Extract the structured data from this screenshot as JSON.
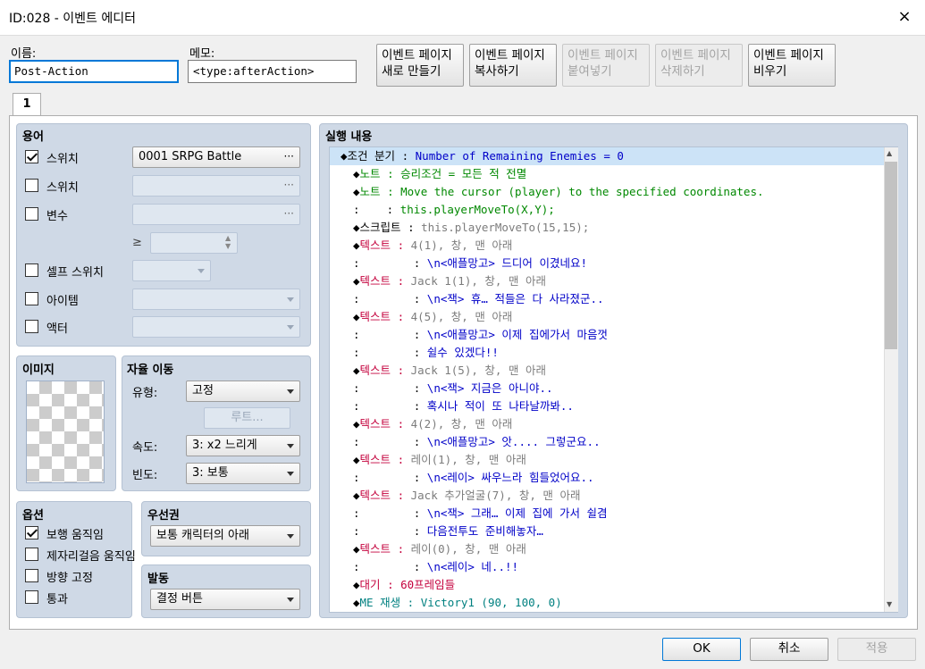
{
  "window": {
    "title": "ID:028 - 이벤트 에디터",
    "close_icon": "×"
  },
  "name": {
    "label": "이름:",
    "value": "Post-Action"
  },
  "memo": {
    "label": "메모:",
    "value": "<type:afterAction>"
  },
  "page_buttons": [
    {
      "line1": "이벤트 페이지",
      "line2": "새로 만들기",
      "enabled": true
    },
    {
      "line1": "이벤트 페이지",
      "line2": "복사하기",
      "enabled": true
    },
    {
      "line1": "이벤트 페이지",
      "line2": "붙여넣기",
      "enabled": false
    },
    {
      "line1": "이벤트 페이지",
      "line2": "삭제하기",
      "enabled": false
    },
    {
      "line1": "이벤트 페이지",
      "line2": "비우기",
      "enabled": true
    }
  ],
  "tab": {
    "label": "1"
  },
  "conditions": {
    "title": "용어",
    "switch1": {
      "label": "스위치",
      "checked": true,
      "value": "0001 SRPG Battle"
    },
    "switch2": {
      "label": "스위치",
      "checked": false
    },
    "variable": {
      "label": "변수",
      "checked": false,
      "ge": "≥"
    },
    "self_switch": {
      "label": "셀프 스위치",
      "checked": false
    },
    "item": {
      "label": "아이템",
      "checked": false
    },
    "actor": {
      "label": "액터",
      "checked": false
    },
    "dots": "···"
  },
  "image": {
    "title": "이미지"
  },
  "autonomous": {
    "title": "자율 이동",
    "type_label": "유형:",
    "type_value": "고정",
    "route_label": "루트...",
    "speed_label": "속도:",
    "speed_value": "3: x2 느리게",
    "freq_label": "빈도:",
    "freq_value": "3: 보통"
  },
  "options": {
    "title": "옵션",
    "items": [
      {
        "label": "보행 움직임",
        "checked": true
      },
      {
        "label": "제자리걸음 움직임",
        "checked": false
      },
      {
        "label": "방향 고정",
        "checked": false
      },
      {
        "label": "통과",
        "checked": false
      }
    ]
  },
  "priority": {
    "title": "우선권",
    "value": "보통 캐릭터의 아래"
  },
  "trigger": {
    "title": "발동",
    "value": "결정 버튼"
  },
  "contents": {
    "title": "실행 내용",
    "lines": [
      {
        "indent": 0,
        "prefix": "◆",
        "cmd": "조건 분기",
        "sep": " : ",
        "text": "Number of Remaining Enemies = 0",
        "cls": "c-blue",
        "cmdcls": "dia"
      },
      {
        "indent": 1,
        "prefix": "◆",
        "cmd": "노트",
        "sep": " : ",
        "text": "승리조건 = 모든 적 전멸",
        "cls": "c-green",
        "cmdcls": "c-green"
      },
      {
        "indent": 1,
        "prefix": "◆",
        "cmd": "노트",
        "sep": " : ",
        "text": "Move the cursor (player) to the specified coordinates.",
        "cls": "c-green",
        "cmdcls": "c-green"
      },
      {
        "indent": 1,
        "prefix": "",
        "cmd": ":",
        "sep": "    : ",
        "text": "this.playerMoveTo(X,Y);",
        "cls": "c-green",
        "cmdcls": "dia"
      },
      {
        "indent": 1,
        "prefix": "◆",
        "cmd": "스크립트",
        "sep": " : ",
        "text": "this.playerMoveTo(15,15);",
        "cls": "c-gray",
        "cmdcls": "dia"
      },
      {
        "indent": 1,
        "prefix": "◆",
        "cmd": "텍스트",
        "sep": " : ",
        "text": "4(1), 창, 맨 아래",
        "cls": "c-gray",
        "cmdcls": "c-red"
      },
      {
        "indent": 1,
        "prefix": "",
        "cmd": ":",
        "sep": "        : ",
        "text": "\\n<애플망고> 드디어 이겼네요!",
        "cls": "c-blue",
        "cmdcls": "dia"
      },
      {
        "indent": 1,
        "prefix": "◆",
        "cmd": "텍스트",
        "sep": " : ",
        "text": "Jack 1(1), 창, 맨 아래",
        "cls": "c-gray",
        "cmdcls": "c-red"
      },
      {
        "indent": 1,
        "prefix": "",
        "cmd": ":",
        "sep": "        : ",
        "text": "\\n<잭> 휴… 적들은 다 사라졌군..",
        "cls": "c-blue",
        "cmdcls": "dia"
      },
      {
        "indent": 1,
        "prefix": "◆",
        "cmd": "텍스트",
        "sep": " : ",
        "text": "4(5), 창, 맨 아래",
        "cls": "c-gray",
        "cmdcls": "c-red"
      },
      {
        "indent": 1,
        "prefix": "",
        "cmd": ":",
        "sep": "        : ",
        "text": "\\n<애플망고> 이제 집에가서 마음껏",
        "cls": "c-blue",
        "cmdcls": "dia"
      },
      {
        "indent": 1,
        "prefix": "",
        "cmd": ":",
        "sep": "        : ",
        "text": "쉴수 있겠다!!",
        "cls": "c-blue",
        "cmdcls": "dia"
      },
      {
        "indent": 1,
        "prefix": "◆",
        "cmd": "텍스트",
        "sep": " : ",
        "text": "Jack 1(5), 창, 맨 아래",
        "cls": "c-gray",
        "cmdcls": "c-red"
      },
      {
        "indent": 1,
        "prefix": "",
        "cmd": ":",
        "sep": "        : ",
        "text": "\\n<잭> 지금은 아니야..",
        "cls": "c-blue",
        "cmdcls": "dia"
      },
      {
        "indent": 1,
        "prefix": "",
        "cmd": ":",
        "sep": "        : ",
        "text": "혹시나 적이 또 나타날까봐..",
        "cls": "c-blue",
        "cmdcls": "dia"
      },
      {
        "indent": 1,
        "prefix": "◆",
        "cmd": "텍스트",
        "sep": " : ",
        "text": "4(2), 창, 맨 아래",
        "cls": "c-gray",
        "cmdcls": "c-red"
      },
      {
        "indent": 1,
        "prefix": "",
        "cmd": ":",
        "sep": "        : ",
        "text": "\\n<애플망고> 앗.... 그렇군요..",
        "cls": "c-blue",
        "cmdcls": "dia"
      },
      {
        "indent": 1,
        "prefix": "◆",
        "cmd": "텍스트",
        "sep": " : ",
        "text": "레이(1), 창, 맨 아래",
        "cls": "c-gray",
        "cmdcls": "c-red"
      },
      {
        "indent": 1,
        "prefix": "",
        "cmd": ":",
        "sep": "        : ",
        "text": "\\n<레이> 싸우느라 힘들었어요..",
        "cls": "c-blue",
        "cmdcls": "dia"
      },
      {
        "indent": 1,
        "prefix": "◆",
        "cmd": "텍스트",
        "sep": " : ",
        "text": "Jack 추가얼굴(7), 창, 맨 아래",
        "cls": "c-gray",
        "cmdcls": "c-red"
      },
      {
        "indent": 1,
        "prefix": "",
        "cmd": ":",
        "sep": "        : ",
        "text": "\\n<잭> 그래… 이제 집에 가서 쉴겸",
        "cls": "c-blue",
        "cmdcls": "dia"
      },
      {
        "indent": 1,
        "prefix": "",
        "cmd": ":",
        "sep": "        : ",
        "text": "다음전투도 준비해놓자…",
        "cls": "c-blue",
        "cmdcls": "dia"
      },
      {
        "indent": 1,
        "prefix": "◆",
        "cmd": "텍스트",
        "sep": " : ",
        "text": "레이(0), 창, 맨 아래",
        "cls": "c-gray",
        "cmdcls": "c-red"
      },
      {
        "indent": 1,
        "prefix": "",
        "cmd": ":",
        "sep": "        : ",
        "text": "\\n<레이> 네..!!",
        "cls": "c-blue",
        "cmdcls": "dia"
      },
      {
        "indent": 1,
        "prefix": "◆",
        "cmd": "대기",
        "sep": " : ",
        "text": "60프레임들",
        "cls": "c-red",
        "cmdcls": "c-red"
      },
      {
        "indent": 1,
        "prefix": "◆",
        "cmd": "ME 재생",
        "sep": " : ",
        "text": "Victory1 (90, 100, 0)",
        "cls": "c-teal",
        "cmdcls": "c-teal"
      }
    ]
  },
  "footer": {
    "ok": "OK",
    "cancel": "취소",
    "apply": "적용"
  }
}
